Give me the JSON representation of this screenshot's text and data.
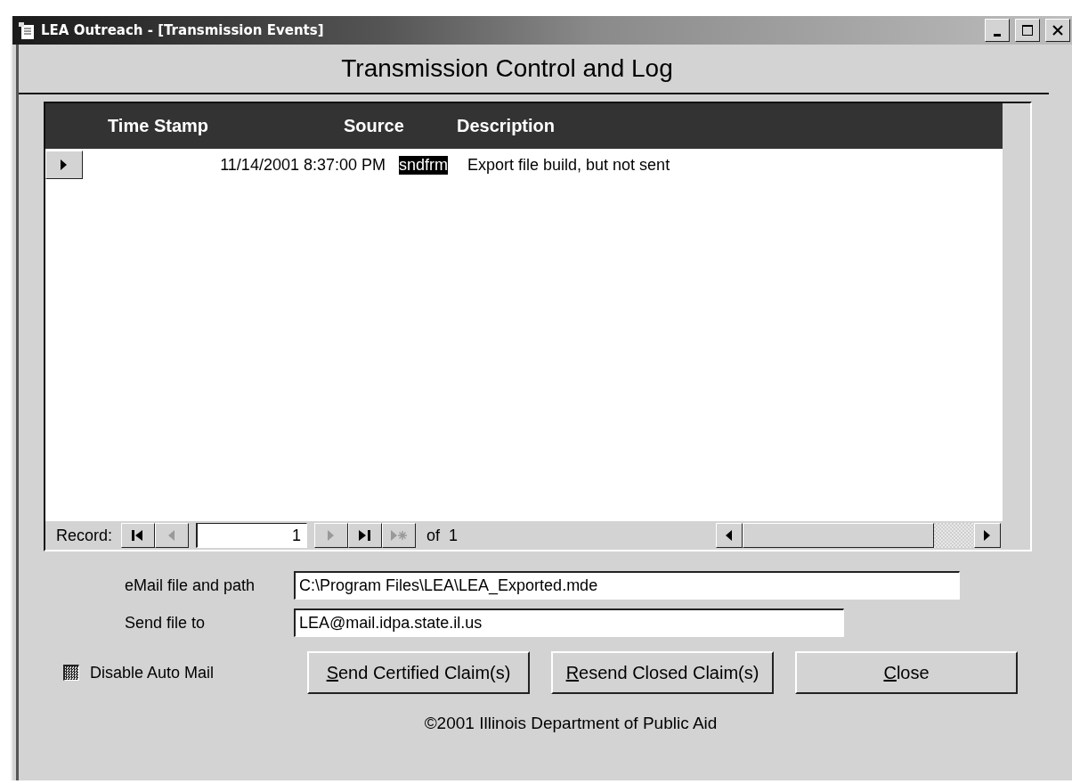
{
  "window": {
    "title": "LEA Outreach - [Transmission Events]"
  },
  "form_title": "Transmission Control and Log",
  "table": {
    "columns": [
      "Time Stamp",
      "Source",
      "Description"
    ],
    "rows": [
      {
        "time_stamp": "11/14/2001 8:37:00 PM",
        "source": "sndfrm",
        "description": "Export file build, but not sent",
        "selected": true,
        "source_highlighted": true
      }
    ]
  },
  "navigator": {
    "label": "Record:",
    "current": "1",
    "of_text": "of  1",
    "buttons": [
      {
        "kind": "first",
        "disabled": false
      },
      {
        "kind": "prev",
        "disabled": true
      },
      {
        "kind": "field"
      },
      {
        "kind": "next",
        "disabled": true
      },
      {
        "kind": "last",
        "disabled": false
      },
      {
        "kind": "new",
        "disabled": true
      }
    ]
  },
  "fields": [
    {
      "label": "eMail file and path",
      "value": "C:\\Program Files\\LEA\\LEA_Exported.mde",
      "wide": true
    },
    {
      "label": "Send file to",
      "value": "LEA@mail.idpa.state.il.us",
      "wide": false
    }
  ],
  "auto_mail": {
    "label": "Disable Auto Mail",
    "indeterminate": true
  },
  "buttons": [
    {
      "label": "Send Certified Claim(s)",
      "first_letter_underlined": true
    },
    {
      "label": "Resend Closed Claim(s)",
      "first_letter_underlined": true
    },
    {
      "label": "Close",
      "first_letter_underlined": true
    }
  ],
  "footer": "©2001 Illinois Department of Public Aid"
}
